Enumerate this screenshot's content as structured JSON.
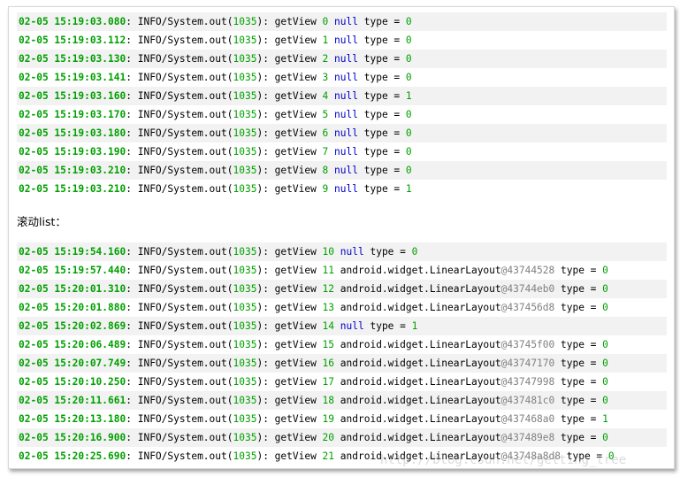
{
  "block1": [
    {
      "ts": "02-05 15:19:03.080",
      "idx": "0",
      "view": "null",
      "type": "0"
    },
    {
      "ts": "02-05 15:19:03.112",
      "idx": "1",
      "view": "null",
      "type": "0"
    },
    {
      "ts": "02-05 15:19:03.130",
      "idx": "2",
      "view": "null",
      "type": "0"
    },
    {
      "ts": "02-05 15:19:03.141",
      "idx": "3",
      "view": "null",
      "type": "0"
    },
    {
      "ts": "02-05 15:19:03.160",
      "idx": "4",
      "view": "null",
      "type": "1"
    },
    {
      "ts": "02-05 15:19:03.170",
      "idx": "5",
      "view": "null",
      "type": "0"
    },
    {
      "ts": "02-05 15:19:03.180",
      "idx": "6",
      "view": "null",
      "type": "0"
    },
    {
      "ts": "02-05 15:19:03.190",
      "idx": "7",
      "view": "null",
      "type": "0"
    },
    {
      "ts": "02-05 15:19:03.210",
      "idx": "8",
      "view": "null",
      "type": "0"
    },
    {
      "ts": "02-05 15:19:03.210",
      "idx": "9",
      "view": "null",
      "type": "1"
    }
  ],
  "separator": "滚动list：",
  "block2": [
    {
      "ts": "02-05 15:19:54.160",
      "idx": "10",
      "view": "null",
      "type": "0"
    },
    {
      "ts": "02-05 15:19:57.440",
      "idx": "11",
      "view": "android.widget.LinearLayout",
      "hash": "@43744528",
      "type": "0"
    },
    {
      "ts": "02-05 15:20:01.310",
      "idx": "12",
      "view": "android.widget.LinearLayout",
      "hash": "@43744eb0",
      "type": "0"
    },
    {
      "ts": "02-05 15:20:01.880",
      "idx": "13",
      "view": "android.widget.LinearLayout",
      "hash": "@437456d8",
      "type": "0"
    },
    {
      "ts": "02-05 15:20:02.869",
      "idx": "14",
      "view": "null",
      "type": "1"
    },
    {
      "ts": "02-05 15:20:06.489",
      "idx": "15",
      "view": "android.widget.LinearLayout",
      "hash": "@43745f00",
      "type": "0"
    },
    {
      "ts": "02-05 15:20:07.749",
      "idx": "16",
      "view": "android.widget.LinearLayout",
      "hash": "@43747170",
      "type": "0"
    },
    {
      "ts": "02-05 15:20:10.250",
      "idx": "17",
      "view": "android.widget.LinearLayout",
      "hash": "@43747998",
      "type": "0"
    },
    {
      "ts": "02-05 15:20:11.661",
      "idx": "18",
      "view": "android.widget.LinearLayout",
      "hash": "@437481c0",
      "type": "0"
    },
    {
      "ts": "02-05 15:20:13.180",
      "idx": "19",
      "view": "android.widget.LinearLayout",
      "hash": "@437468a0",
      "type": "1"
    },
    {
      "ts": "02-05 15:20:16.900",
      "idx": "20",
      "view": "android.widget.LinearLayout",
      "hash": "@437489e8",
      "type": "0"
    },
    {
      "ts": "02-05 15:20:25.690",
      "idx": "21",
      "view": "android.widget.LinearLayout",
      "hash": "@43748a8d8",
      "type": "0"
    }
  ],
  "log_tag": "INFO/System.out(",
  "pid": "1035",
  "log_tag_close": "):",
  "method": "getView",
  "type_label": "type =",
  "watermark": "http://blog.csdn.net/getting_tree",
  "colors": {
    "timestamp": "#00a000",
    "keyword": "#0000c8",
    "hash": "#808080",
    "row_alt": "#f2f2f2"
  }
}
